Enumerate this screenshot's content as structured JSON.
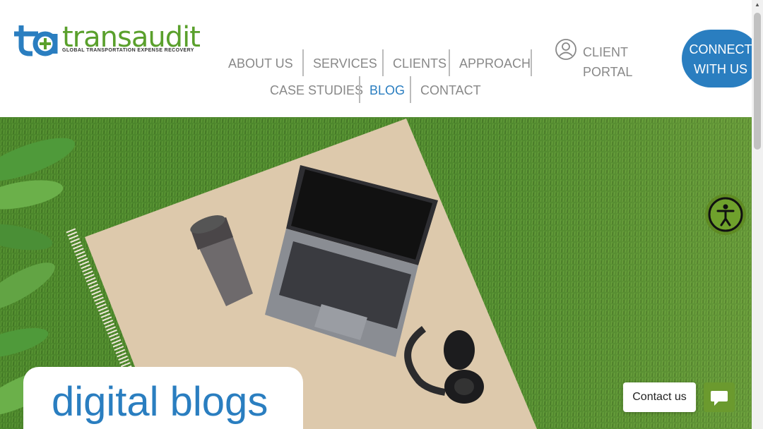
{
  "brand": {
    "name": "transaudit",
    "tagline": "GLOBAL TRANSPORTATION EXPENSE RECOVERY",
    "primary_color": "#2a7ec0",
    "accent_color": "#5aa02c"
  },
  "nav": {
    "row1": [
      "ABOUT US",
      "SERVICES",
      "CLIENTS",
      "APPROACH"
    ],
    "row2": [
      "CASE STUDIES",
      "BLOG",
      "CONTACT"
    ],
    "active": "BLOG"
  },
  "client_portal": {
    "line1": "CLIENT",
    "line2": "PORTAL",
    "icon": "user-circle-icon"
  },
  "connect": {
    "line1": "CONNECT",
    "line2": "WITH US"
  },
  "hero": {
    "title": "digital blogs"
  },
  "widgets": {
    "contact_label": "Contact us",
    "chat_icon": "chat-icon",
    "accessibility_icon": "accessibility-icon"
  }
}
